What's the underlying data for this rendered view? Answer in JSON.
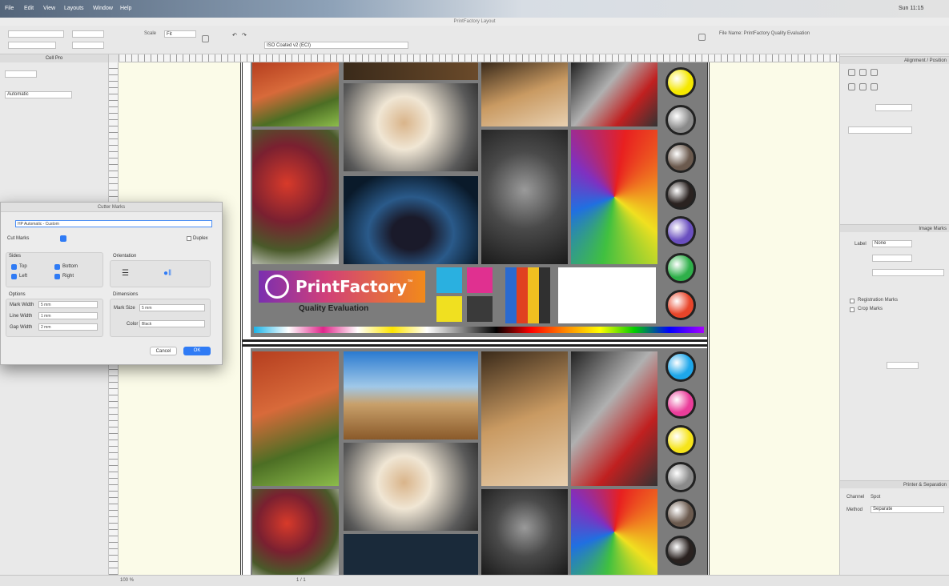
{
  "menubar": {
    "items": [
      "File",
      "Edit",
      "View",
      "Layouts",
      "Window",
      "Help"
    ],
    "clock": "Sun 11:15"
  },
  "window": {
    "title": "PrintFactory Layout"
  },
  "toolbar": {
    "scale": "Scale",
    "fit": "Fit",
    "profile": "ISO Coated v2 (ECI)",
    "file": "File Name: PrintFactory Quality Evaluation"
  },
  "leftpanel": {
    "title": "Cell Pro",
    "mode": "Automatic"
  },
  "dialog": {
    "title": "Cutter Marks",
    "name": "HP Automatic - Custom",
    "type": "Cut Marks",
    "duplex": "Duplex",
    "sides_label": "Sides",
    "top": "Top",
    "bottom": "Bottom",
    "left": "Left",
    "right": "Right",
    "orientation": "Orientation",
    "options_label": "Options",
    "mark_width_label": "Mark Width",
    "mark_width": "5 mm",
    "line_width_label": "Line Width",
    "line_width": "1 mm",
    "gap_width_label": "Gap Width",
    "gap_width": "2 mm",
    "dimensions": "Dimensions",
    "mark_size_label": "Mark Size",
    "mark_size": "5 mm",
    "color_label": "Color",
    "color": "Black",
    "cancel": "Cancel",
    "ok": "OK"
  },
  "sheet": {
    "logo_text": "PrintFactory",
    "logo_tm": "™",
    "tagline": "Quality Evaluation"
  },
  "rightpanel": {
    "panel1": "Alignment / Position",
    "panel2": "Image Marks",
    "label_label": "Label",
    "label_value": "None",
    "reg_label": "Registration Marks",
    "crop_label": "Crop Marks",
    "panel3": "Printer & Separation",
    "channel_label": "Channel",
    "method_label": "Method",
    "channel": "Spot",
    "method": "Separate"
  },
  "statusbar": {
    "zoom": "100 %",
    "page": "1 / 1"
  },
  "colors": {
    "swatches1": [
      "#f5e800",
      "#8a8a8a",
      "#6b5a4e",
      "#2a2220",
      "#6a4fc0",
      "#2fb04a",
      "#e8452a"
    ],
    "swatches2": [
      "#1ea7ea",
      "#ea3d9a",
      "#f6e41a",
      "#8a8a8a",
      "#6b5a4e",
      "#2a2220"
    ]
  }
}
